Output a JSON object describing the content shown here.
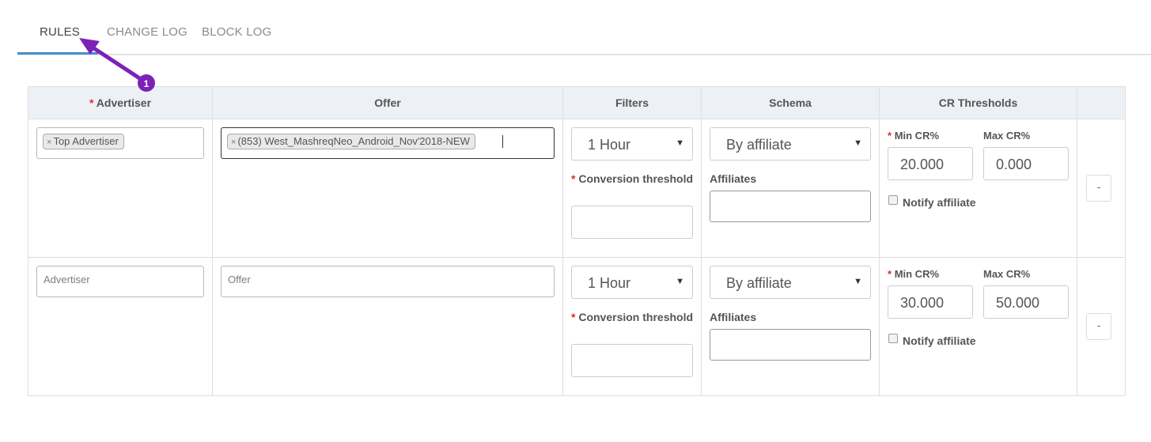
{
  "tabs": [
    {
      "label": "RULES",
      "active": true
    },
    {
      "label": "CHANGE LOG",
      "active": false
    },
    {
      "label": "BLOCK LOG",
      "active": false
    }
  ],
  "table": {
    "required_mark": "*",
    "headers": {
      "advertiser": "Advertiser",
      "offer": "Offer",
      "filters": "Filters",
      "schema": "Schema",
      "cr_thresholds": "CR Thresholds",
      "actions": ""
    },
    "labels": {
      "conversion_threshold": "Conversion threshold",
      "affiliates": "Affiliates",
      "min_cr": "Min CR%",
      "max_cr": "Max CR%",
      "notify_affiliate": "Notify affiliate",
      "remove": "-",
      "chip_remove": "×"
    },
    "placeholders": {
      "advertiser": "Advertiser",
      "offer": "Offer"
    },
    "rows": [
      {
        "advertiser_tag": "Top Advertiser",
        "offer_tag": "(853) West_MashreqNeo_Android_Nov'2018-NEW",
        "filter": "1 Hour",
        "conversion_threshold": "",
        "schema": "By affiliate",
        "affiliates": "",
        "min_cr": "20.000",
        "max_cr": "0.000",
        "notify_affiliate": false
      },
      {
        "advertiser_tag": "",
        "offer_tag": "",
        "filter": "1 Hour",
        "conversion_threshold": "",
        "schema": "By affiliate",
        "affiliates": "",
        "min_cr": "30.000",
        "max_cr": "50.000",
        "notify_affiliate": false
      }
    ]
  },
  "annotation": {
    "step": "1",
    "color": "#7b22b8"
  },
  "colors": {
    "tab_underline": "#4a90c8",
    "header_bg": "#edf0f5",
    "required": "#d9302c"
  }
}
